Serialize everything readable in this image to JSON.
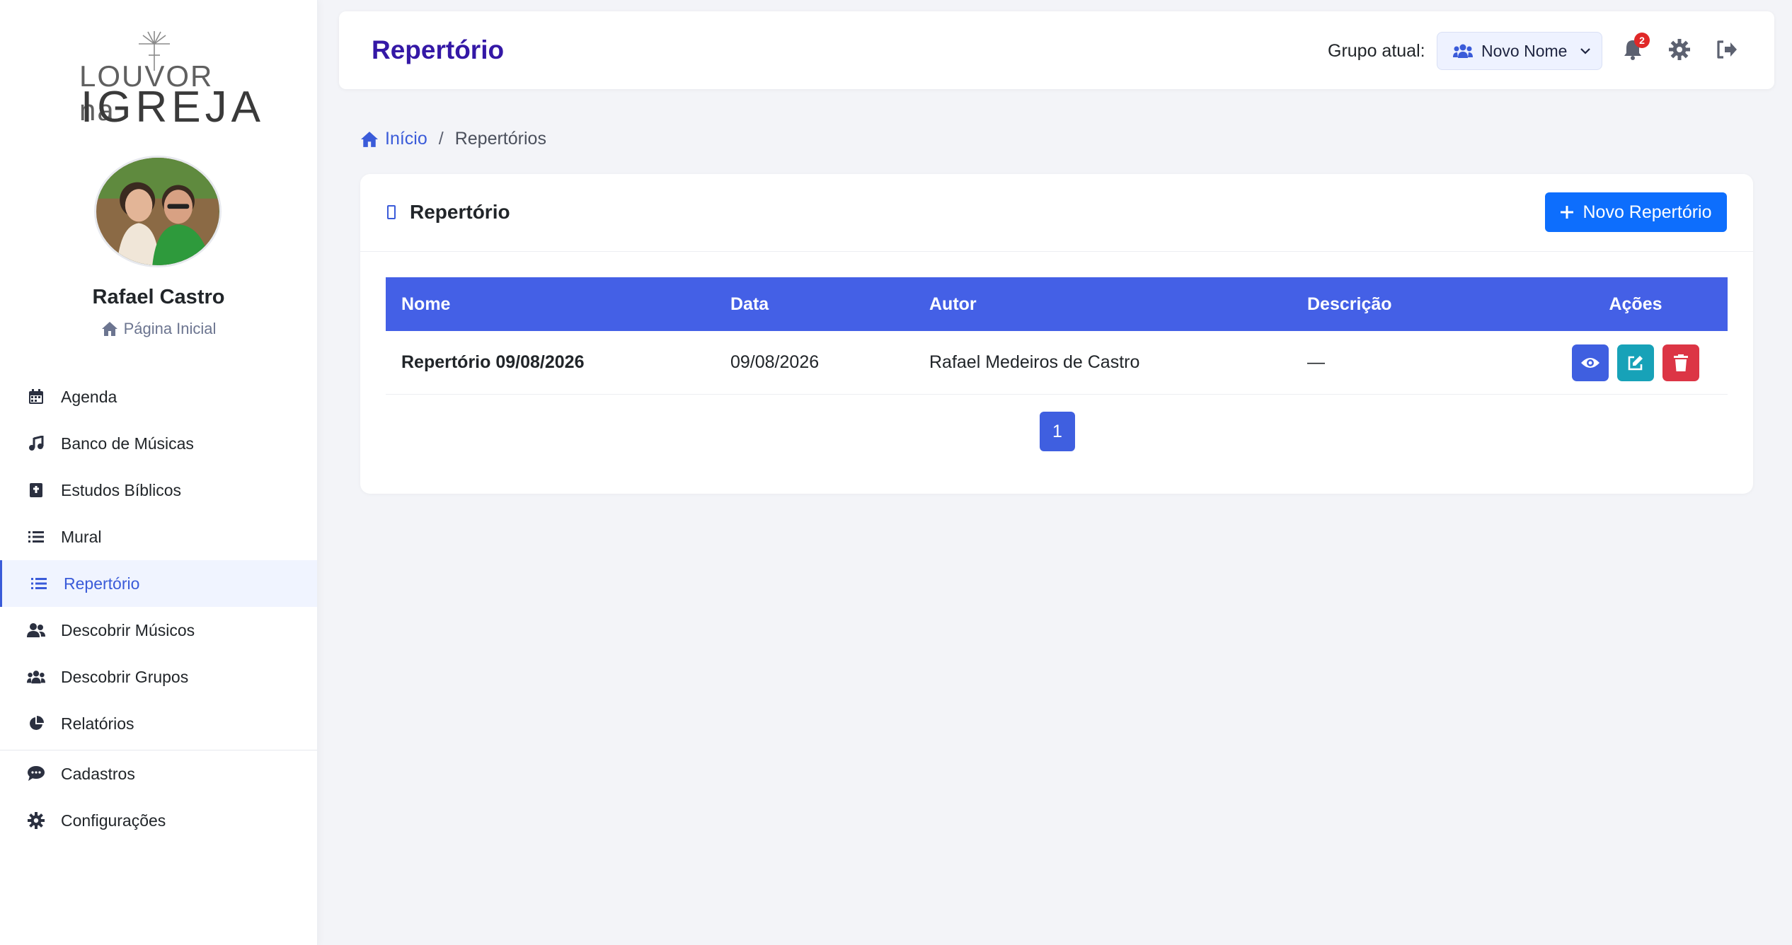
{
  "brand": {
    "line1": "LOUVOR na",
    "line2": "IGREJA"
  },
  "user": {
    "name": "Rafael Castro",
    "home_label": "Página Inicial"
  },
  "sidebar": {
    "items": [
      {
        "label": "Agenda",
        "icon": "calendar-icon"
      },
      {
        "label": "Banco de Músicas",
        "icon": "music-icon"
      },
      {
        "label": "Estudos Bíblicos",
        "icon": "bible-icon"
      },
      {
        "label": "Mural",
        "icon": "list-icon"
      },
      {
        "label": "Repertório",
        "icon": "list-icon",
        "active": true
      },
      {
        "label": "Descobrir Músicos",
        "icon": "users-icon"
      },
      {
        "label": "Descobrir Grupos",
        "icon": "group-icon"
      },
      {
        "label": "Relatórios",
        "icon": "pie-chart-icon"
      },
      {
        "label": "Cadastros",
        "icon": "comment-icon"
      },
      {
        "label": "Configurações",
        "icon": "gear-icon"
      }
    ]
  },
  "header": {
    "title": "Repertório",
    "group_label": "Grupo atual:",
    "group_value": "Novo Nome",
    "notifications_count": "2"
  },
  "breadcrumb": {
    "home": "Início",
    "separator": "/",
    "current": "Repertórios"
  },
  "card": {
    "title": "Repertório",
    "new_button": "Novo Repertório",
    "columns": [
      "Nome",
      "Data",
      "Autor",
      "Descrição",
      "Ações"
    ],
    "rows": [
      {
        "nome": "Repertório 09/08/2026",
        "data": "09/08/2026",
        "autor": "Rafael Medeiros de Castro",
        "descricao": "—"
      }
    ],
    "page": "1"
  },
  "colors": {
    "accent": "#3a5bd9",
    "title": "#3418a6",
    "table_header": "#4460e6",
    "primary_btn": "#0d6efd",
    "edit": "#17a2b8",
    "delete": "#dc3545"
  }
}
